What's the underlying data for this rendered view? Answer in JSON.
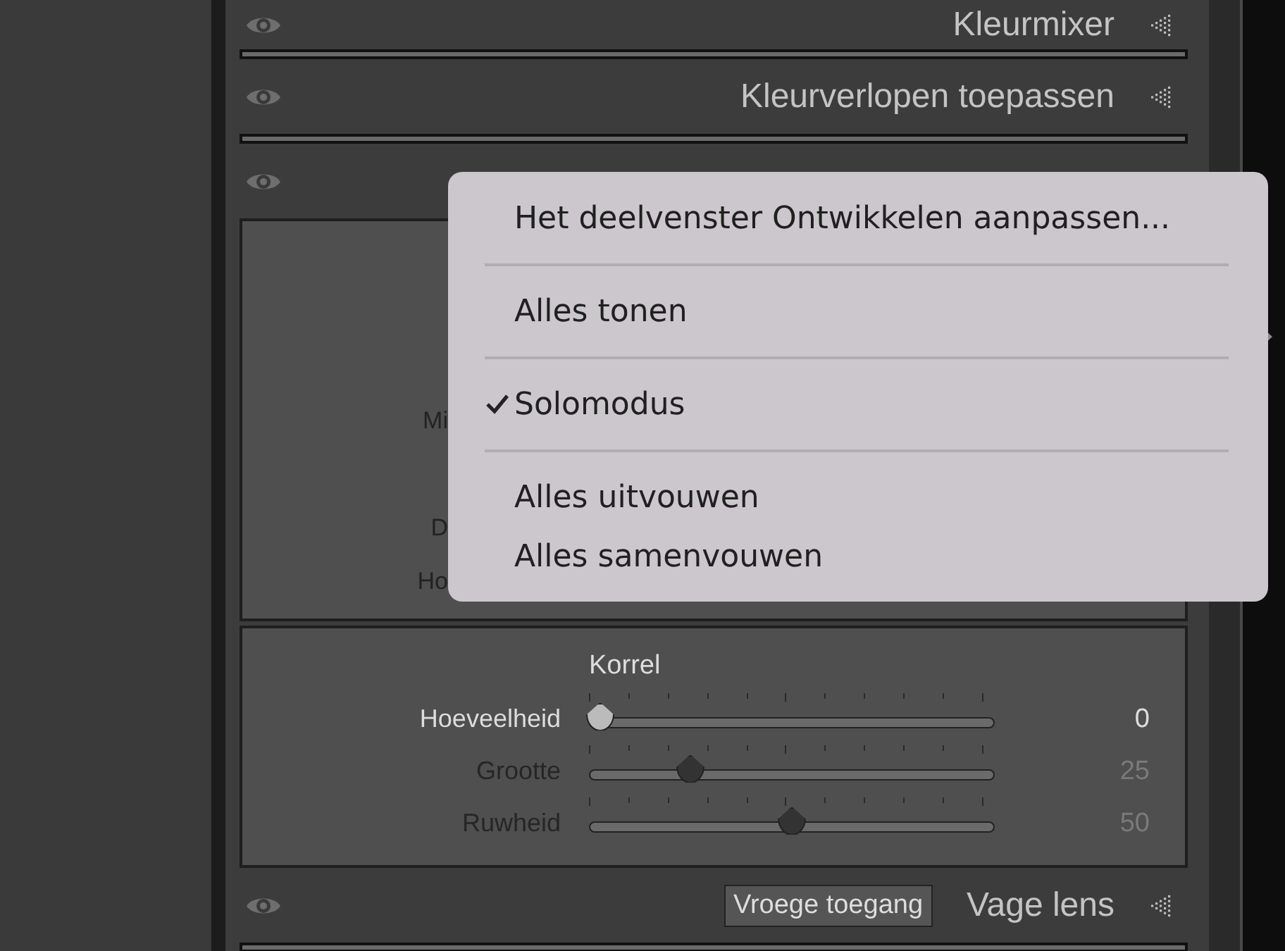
{
  "panels": [
    {
      "kind": "header",
      "title": "Kleurmixer"
    },
    {
      "kind": "header",
      "title": "Kleurverlopen toepassen"
    },
    {
      "kind": "effects",
      "labels": [
        "Mi",
        "D",
        "Ho"
      ],
      "grain": {
        "title": "Korrel",
        "sliders": [
          {
            "label": "Hoeveelheid",
            "value": "0",
            "level": 0,
            "disabled": false
          },
          {
            "label": "Grootte",
            "value": "25",
            "level": 0.25,
            "disabled": true
          },
          {
            "label": "Ruwheid",
            "value": "50",
            "level": 0.5,
            "disabled": true
          }
        ]
      }
    },
    {
      "kind": "header",
      "title": "Vage lens",
      "badge": "Vroege toegang"
    }
  ],
  "menu": {
    "items": [
      {
        "label": "Het deelvenster Ontwikkelen aanpassen...",
        "checked": false,
        "separator_after": true
      },
      {
        "label": "Alles tonen",
        "checked": false,
        "separator_after": true
      },
      {
        "label": "Solomodus",
        "checked": true,
        "separator_after": true
      },
      {
        "label": "Alles uitvouwen",
        "checked": false,
        "separator_after": false
      },
      {
        "label": "Alles samenvouwen",
        "checked": false,
        "separator_after": false
      }
    ]
  }
}
